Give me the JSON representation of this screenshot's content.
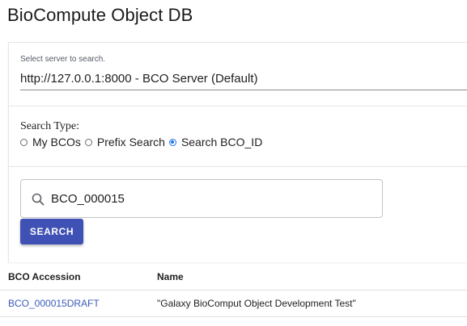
{
  "app": {
    "title": "BioCompute Object DB"
  },
  "server": {
    "label": "Select server to search.",
    "selected": "http://127.0.0.1:8000 - BCO Server (Default)"
  },
  "search_type": {
    "title": "Search Type:",
    "options": [
      {
        "label": "My BCOs",
        "checked": false
      },
      {
        "label": "Prefix Search",
        "checked": false
      },
      {
        "label": "Search BCO_ID",
        "checked": true
      }
    ]
  },
  "search": {
    "value": "BCO_000015",
    "button_label": "SEARCH",
    "icon": "search-icon"
  },
  "results": {
    "columns": [
      "BCO Accession",
      "Name"
    ],
    "rows": [
      {
        "accession": "BCO_000015DRAFT",
        "name": "\"Galaxy BioComput Object Development Test\""
      }
    ]
  },
  "colors": {
    "accent": "#3f51b5",
    "link": "#3b5ab8",
    "radio_selected": "#1a73e8"
  }
}
